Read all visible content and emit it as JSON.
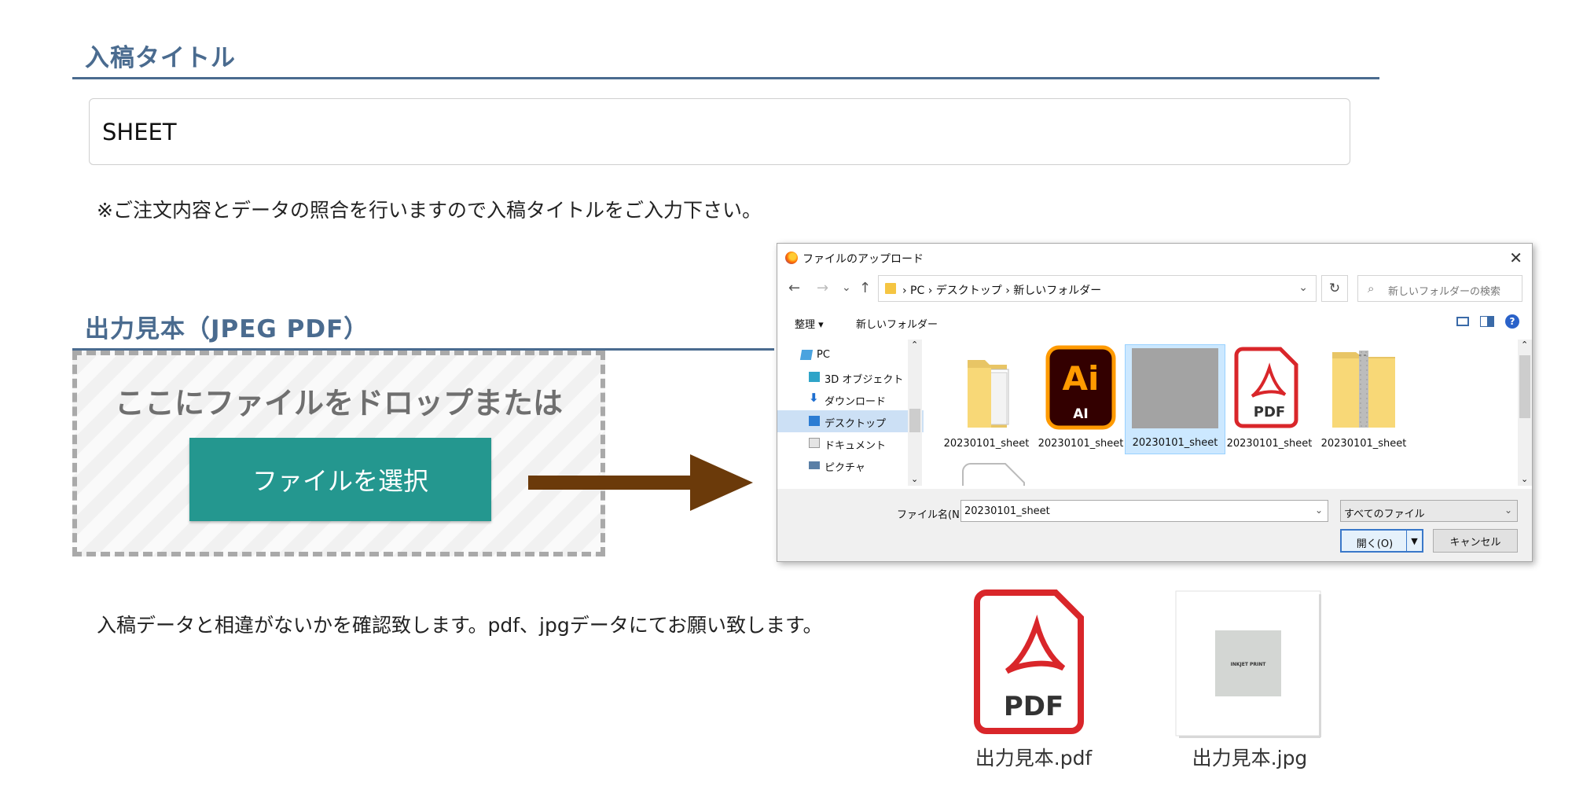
{
  "upload_title": {
    "heading": "入稿タイトル",
    "input_value": "SHEET",
    "note": "※ご注文内容とデータの照合を行いますので入稿タイトルをご入力下さい。"
  },
  "sample_output": {
    "heading": "出力見本（JPEG PDF）",
    "drop_text": "ここにファイルをドロップまたは",
    "select_button": "ファイルを選択",
    "note": "入稿データと相違がないかを確認致します。pdf、jpgデータにてお願い致します。"
  },
  "dialog": {
    "title": "ファイルのアップロード",
    "close": "✕",
    "nav": {
      "back": "←",
      "forward": "→",
      "recent": "⌄",
      "up": "↑"
    },
    "breadcrumb": "›  PC  ›  デスクトップ  ›  新しいフォルダー",
    "refresh": "↻",
    "search_placeholder": "新しいフォルダーの検索",
    "commands": {
      "organize": "整理 ▾",
      "new_folder": "新しいフォルダー",
      "help": "?"
    },
    "tree": [
      {
        "label": "PC",
        "icon": "pc-icon"
      },
      {
        "label": "3D オブジェクト",
        "icon": "cube-icon"
      },
      {
        "label": "ダウンロード",
        "icon": "download-icon"
      },
      {
        "label": "デスクトップ",
        "icon": "desktop-icon",
        "selected": true
      },
      {
        "label": "ドキュメント",
        "icon": "document-icon"
      },
      {
        "label": "ピクチャ",
        "icon": "pictures-icon"
      }
    ],
    "files": [
      {
        "name": "20230101_sheet",
        "icon": "folder-icon"
      },
      {
        "name": "20230101_sheet",
        "icon": "illustrator-icon",
        "icon_text_top": "Ai",
        "icon_text_bottom": "AI"
      },
      {
        "name": "20230101_sheet",
        "icon": "gray-image-icon",
        "selected": true
      },
      {
        "name": "20230101_sheet",
        "icon": "pdf-icon",
        "icon_text": "PDF"
      },
      {
        "name": "20230101_sheet",
        "icon": "zip-folder-icon"
      }
    ],
    "filename_label": "ファイル名(N):",
    "filename_value": "20230101_sheet",
    "filetype_value": "すべてのファイル",
    "open_button": "開く(O)",
    "cancel_button": "キャンセル"
  },
  "previews": [
    {
      "name": "出力見本.pdf",
      "icon": "pdf-icon",
      "icon_text": "PDF"
    },
    {
      "name": "出力見本.jpg",
      "icon": "jpg-thumbnail-icon",
      "thumb_text": "INKJET PRINT"
    }
  ],
  "colors": {
    "heading": "#4a6b8f",
    "select_button": "#24978f",
    "arrow": "#6b3a0a",
    "pdf_red": "#d9262a",
    "ai_orange": "#ff9a00",
    "ai_dark": "#330000"
  }
}
